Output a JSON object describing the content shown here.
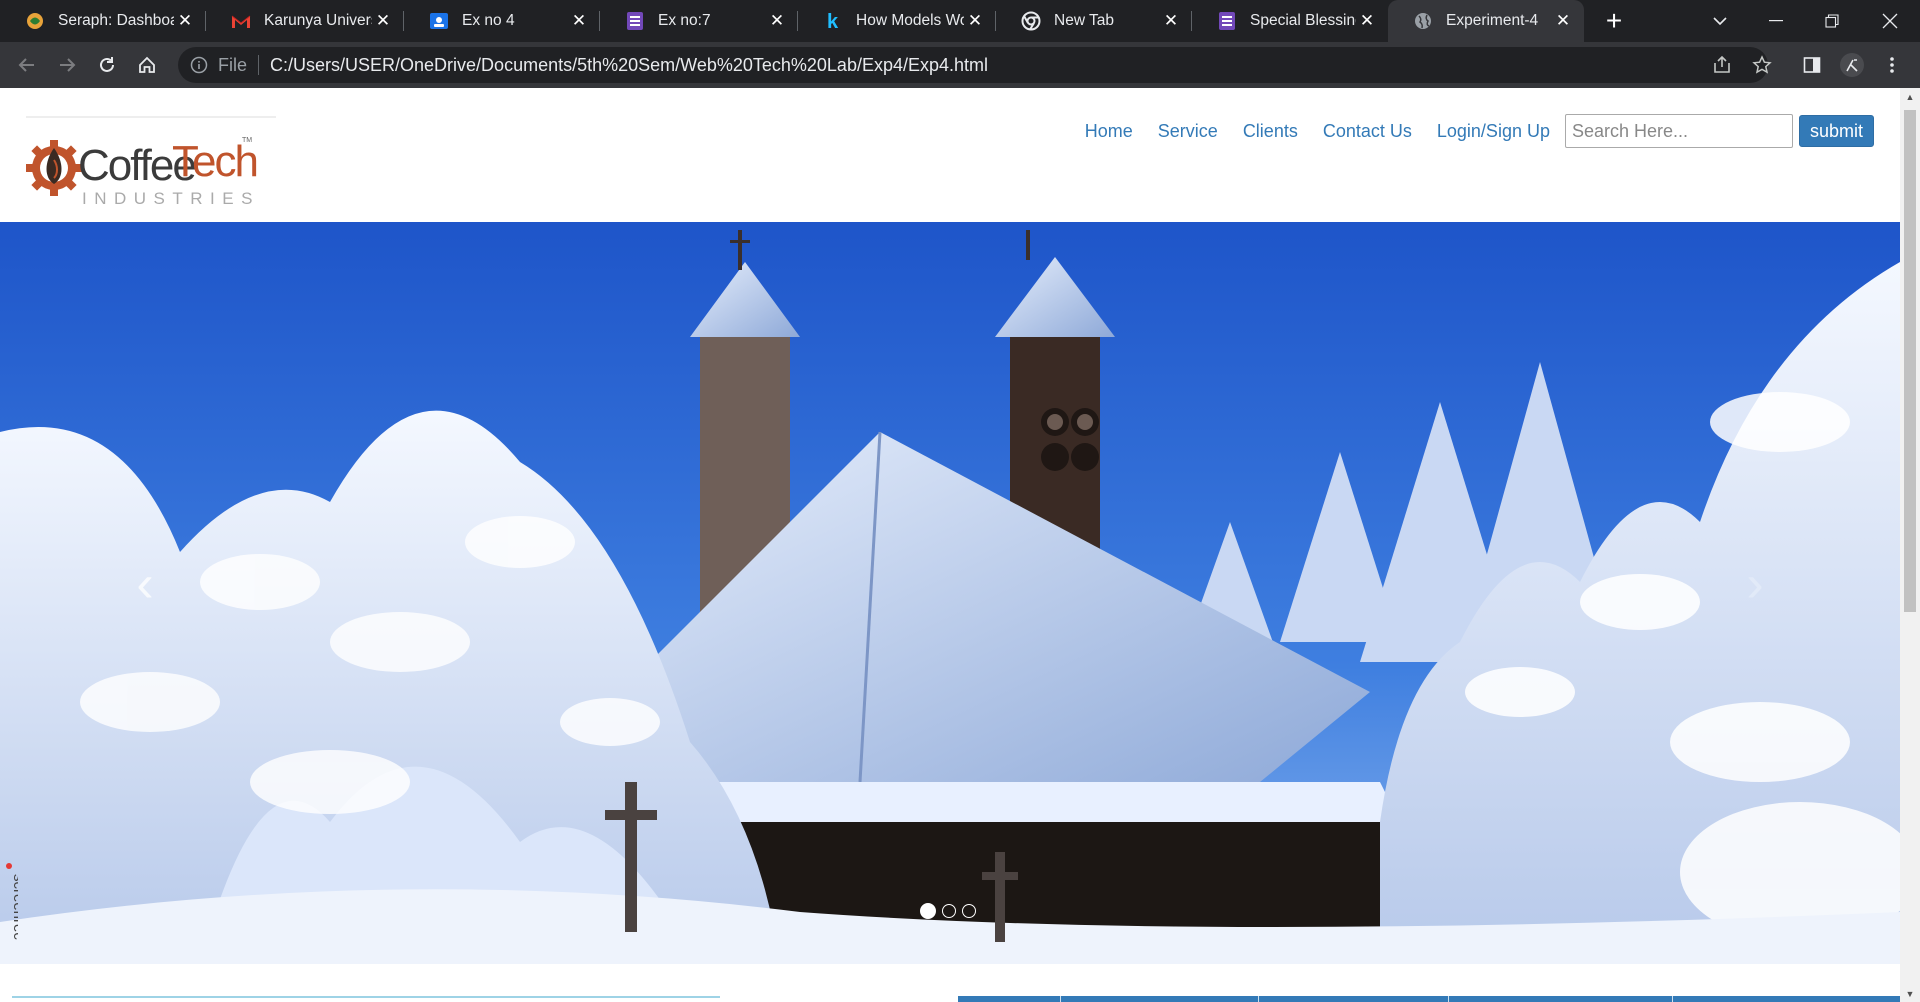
{
  "browser": {
    "tabs": [
      {
        "title": "Seraph: Dashboard",
        "icon": "seraph-favicon-icon"
      },
      {
        "title": "Karunya University",
        "icon": "gmail-favicon-icon"
      },
      {
        "title": "Ex no 4",
        "icon": "classroom-favicon-icon"
      },
      {
        "title": "Ex no:7",
        "icon": "forms-favicon-icon"
      },
      {
        "title": "How Models Work",
        "icon": "kaggle-favicon-icon"
      },
      {
        "title": "New Tab",
        "icon": "chrome-favicon-icon"
      },
      {
        "title": "Special Blessing M",
        "icon": "forms-favicon-icon"
      },
      {
        "title": "Experiment-4",
        "icon": "globe-favicon-icon"
      }
    ],
    "active_tab": 7,
    "address": {
      "scheme_label": "File",
      "url": "C:/Users/USER/OneDrive/Documents/5th%20Sem/Web%20Tech%20Lab/Exp4/Exp4.html"
    }
  },
  "site": {
    "logo": {
      "word1": "Coffee",
      "word2": "Tech",
      "tm": "TM",
      "sub": "INDUSTRIES"
    },
    "nav": [
      "Home",
      "Service",
      "Clients",
      "Contact Us",
      "Login/Sign Up"
    ],
    "search": {
      "placeholder": "Search Here...",
      "value": ""
    },
    "submit_label": "submit",
    "carousel": {
      "slides": 3,
      "active": 0,
      "prev_glyph": "‹",
      "next_glyph": "›"
    }
  },
  "watermark": {
    "text": "screenrec"
  }
}
